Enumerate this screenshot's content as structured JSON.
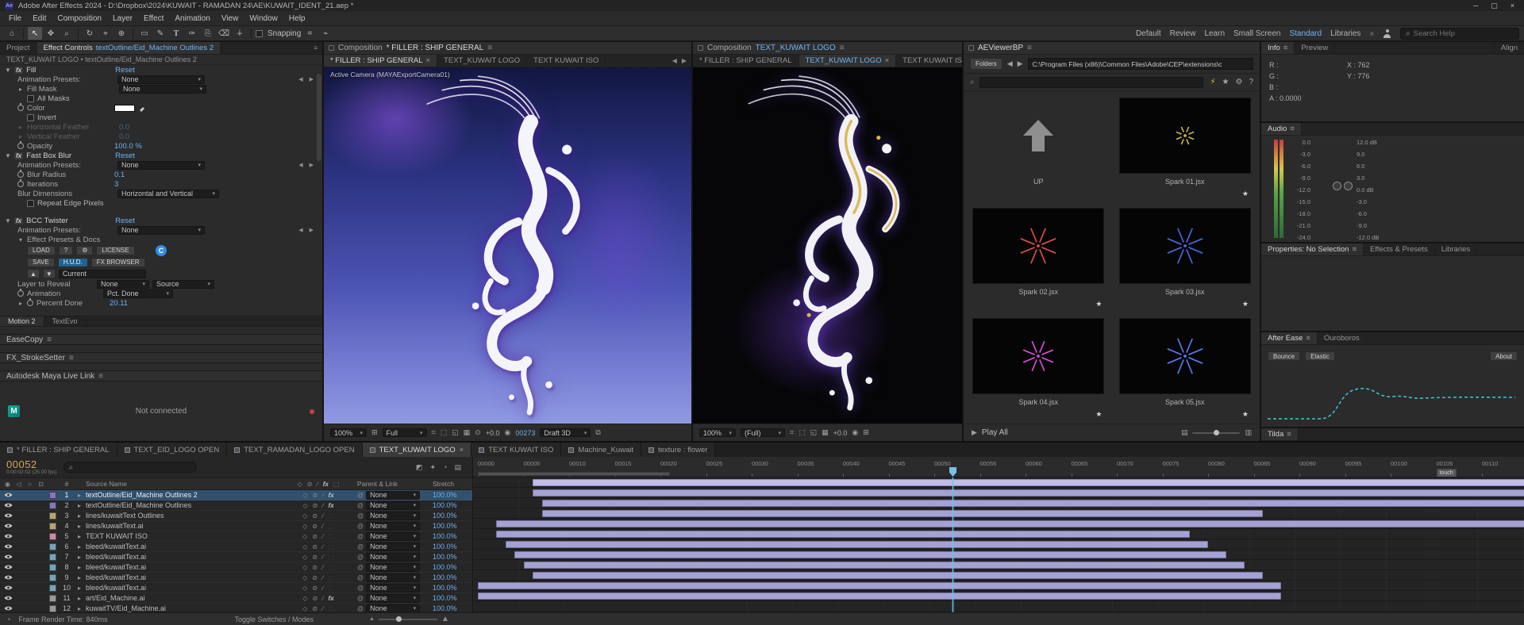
{
  "titlebar": {
    "title": "Adobe After Effects 2024 - D:\\Dropbox\\2024\\KUWAIT - RAMADAN 24\\AE\\KUWAIT_IDENT_21.aep *"
  },
  "menubar": [
    "File",
    "Edit",
    "Composition",
    "Layer",
    "Effect",
    "Animation",
    "View",
    "Window",
    "Help"
  ],
  "toolbar": {
    "snapping": "Snapping",
    "workspaces": [
      "Default",
      "Review",
      "Learn",
      "Small Screen",
      "Standard",
      "Libraries"
    ],
    "active_workspace": "Standard",
    "search_placeholder": "Search Help"
  },
  "effect_controls": {
    "project_tab": "Project",
    "panel_tab": "Effect Controls",
    "panel_target": "textOutline/Eid_Machine Outlines 2",
    "comp_crumb": "TEXT_KUWAIT LOGO • textOutline/Eid_Machine Outlines 2",
    "animation_presets_label": "Animation Presets:",
    "fill": {
      "name": "Fill",
      "reset": "Reset",
      "animation_presets": "None",
      "fill_mask_label": "Fill Mask",
      "fill_mask": "None",
      "all_masks": "All Masks",
      "color_label": "Color",
      "invert": "Invert",
      "h_feather_label": "Horizontal Feather",
      "h_feather": "0.0",
      "v_feather_label": "Vertical Feather",
      "v_feather": "0.0",
      "opacity_label": "Opacity",
      "opacity": "100.0 %"
    },
    "fast_box_blur": {
      "name": "Fast Box Blur",
      "reset": "Reset",
      "animation_presets": "None",
      "blur_radius_label": "Blur Radius",
      "blur_radius": "0.1",
      "iterations_label": "Iterations",
      "iterations": "3",
      "blur_dimensions_label": "Blur Dimensions",
      "blur_dimensions": "Horizontal and Vertical",
      "repeat_edge": "Repeat Edge Pixels"
    },
    "bcc_twister": {
      "name": "BCC Twister",
      "reset": "Reset",
      "animation_presets": "None",
      "presets_docs": "Effect Presets & Docs",
      "load": "LOAD",
      "help": "?",
      "license": "LICENSE",
      "save": "SAVE",
      "hud": "H.U.D.",
      "fx_browser": "FX BROWSER",
      "logo_letter": "C",
      "current": "Current",
      "layer_to_reveal_label": "Layer to Reveal",
      "layer_to_reveal": "None",
      "source": "Source",
      "animation_label": "Animation",
      "animation": "Pct. Done",
      "percent_done_label": "Percent Done",
      "percent_done": "20.11"
    },
    "bottom_tabs": [
      "Motion 2",
      "TextEvo"
    ],
    "easecopy": "EaseCopy",
    "fx_strokesetter": "FX_StrokeSetter",
    "maya_title": "Autodesk Maya Live Link",
    "maya_status": "Not connected"
  },
  "comp1": {
    "panel_title": "Composition",
    "panel_comp": "* FILLER : SHIP GENERAL",
    "tabs": [
      "* FILLER : SHIP GENERAL",
      "TEXT_KUWAIT LOGO",
      "TEXT KUWAIT ISO"
    ],
    "active_tab": 0,
    "camera_label": "Active Camera (MAYAExportCamera01)",
    "zoom": "100%",
    "resolution": "Full",
    "exposure": "+0.0",
    "frame": "00273",
    "renderer": "Draft 3D"
  },
  "comp2": {
    "panel_title": "Composition",
    "panel_comp": "TEXT_KUWAIT LOGO",
    "tabs": [
      "* FILLER : SHIP GENERAL",
      "TEXT_KUWAIT LOGO",
      "TEXT KUWAIT ISO"
    ],
    "active_tab": 1,
    "zoom": "100%",
    "resolution": "(Full)",
    "exposure": "+0.0"
  },
  "aeviewer": {
    "title": "AEViewerBP",
    "folders_button": "Folders",
    "path": "C:\\Program Files (x86)\\Common Files\\Adobe\\CEP\\extensions\\c",
    "items": [
      {
        "label": "UP",
        "type": "up"
      },
      {
        "label": "Spark 01.jsx",
        "type": "spark",
        "color": "#c7b24a",
        "size": 20
      },
      {
        "label": "Spark 02.jsx",
        "type": "spark",
        "color": "#e04a50",
        "size": 40
      },
      {
        "label": "Spark 03.jsx",
        "type": "spark",
        "color": "#4a66e0",
        "size": 40
      },
      {
        "label": "Spark 04.jsx",
        "type": "spark",
        "color": "#d84ad8",
        "size": 34
      },
      {
        "label": "Spark 05.jsx",
        "type": "spark",
        "color": "#5a7ae8",
        "size": 40
      }
    ],
    "play_all": "Play All"
  },
  "info_panel": {
    "tab_info": "Info",
    "tab_preview": "Preview",
    "tab_align": "Align",
    "r": "R :",
    "g": "G :",
    "b": "B :",
    "a": "A : 0.0000",
    "x": "X : 762",
    "y": "Y : 776"
  },
  "audio_panel": {
    "title": "Audio",
    "left_scale": [
      "0.0",
      "-3.0",
      "-6.0",
      "-9.0",
      "-12.0",
      "-15.0",
      "-18.0",
      "-21.0",
      "-24.0"
    ],
    "right_scale": [
      "12.0 dB",
      "9.0",
      "6.0",
      "3.0",
      "0.0 dB",
      "-3.0",
      "-6.0",
      "-9.0",
      "-12.0 dB"
    ]
  },
  "right_tabs": {
    "properties": "Properties: No Selection",
    "effects_presets": "Effects & Presets",
    "libraries": "Libraries"
  },
  "after_ease": {
    "tab1": "After Ease",
    "tab2": "Ouroboros",
    "bounce": "Bounce",
    "elastic": "Elastic",
    "about": "About"
  },
  "tilda": {
    "title": "Tilda"
  },
  "timeline": {
    "comp_tabs": [
      {
        "label": "* FILLER : SHIP GENERAL",
        "active": false
      },
      {
        "label": "TEXT_EID_LOGO OPEN",
        "active": false
      },
      {
        "label": "TEXT_RAMADAN_LOGO OPEN",
        "active": false
      },
      {
        "label": "TEXT_KUWAIT LOGO",
        "active": true
      },
      {
        "label": "TEXT KUWAIT ISO",
        "active": false
      },
      {
        "label": "Machine_Kuwait",
        "active": false
      },
      {
        "label": "texture : flower",
        "active": false
      }
    ],
    "timecode": "00052",
    "timecode_sub": "0:00:02:02 (25.00 fps)",
    "columns": {
      "source_name": "Source Name",
      "parent_link": "Parent & Link",
      "stretch": "Stretch",
      "number": "#"
    },
    "current_frame": 52,
    "work_area": {
      "start": 0,
      "end": 21
    },
    "marker_label": "touch",
    "marker_frame": 105,
    "ruler_ticks": [
      "00000",
      "00005",
      "00010",
      "00015",
      "00020",
      "00025",
      "00030",
      "00035",
      "00040",
      "00045",
      "00050",
      "00055",
      "00060",
      "00065",
      "00070",
      "00075",
      "00080",
      "00085",
      "00090",
      "00095",
      "00100",
      "00105",
      "00110"
    ],
    "layers": [
      {
        "num": "1",
        "name": "textOutline/Eid_Machine Outlines 2",
        "parent_link": "None",
        "stretch": "100.0%",
        "label_color": "#8577b5",
        "bar_start": 6,
        "bar_end": 116,
        "selected": true,
        "has_fx": true
      },
      {
        "num": "2",
        "name": "textOutline/Eid_Machine Outlines",
        "parent_link": "None",
        "stretch": "100.0%",
        "label_color": "#8577b5",
        "bar_start": 6,
        "bar_end": 116,
        "selected": false,
        "has_fx": true
      },
      {
        "num": "3",
        "name": "lines/kuwaitText Outlines",
        "parent_link": "None",
        "stretch": "100.0%",
        "label_color": "#b5a477",
        "bar_start": 7,
        "bar_end": 116,
        "selected": false,
        "has_fx": false
      },
      {
        "num": "4",
        "name": "lines/kuwaitText.ai",
        "parent_link": "None",
        "stretch": "100.0%",
        "label_color": "#b5a477",
        "bar_start": 7,
        "bar_end": 86,
        "selected": false,
        "has_fx": false
      },
      {
        "num": "5",
        "name": "TEXT KUWAIT ISO",
        "parent_link": "None",
        "stretch": "100.0%",
        "label_color": "#c98ba6",
        "bar_start": 2,
        "bar_end": 116,
        "selected": false,
        "has_fx": false
      },
      {
        "num": "6",
        "name": "bleed/kuwaitText.ai",
        "parent_link": "None",
        "stretch": "100.0%",
        "label_color": "#77a3b5",
        "bar_start": 2,
        "bar_end": 78,
        "selected": false,
        "has_fx": false
      },
      {
        "num": "7",
        "name": "bleed/kuwaitText.ai",
        "parent_link": "None",
        "stretch": "100.0%",
        "label_color": "#77a3b5",
        "bar_start": 3,
        "bar_end": 80,
        "selected": false,
        "has_fx": false
      },
      {
        "num": "8",
        "name": "bleed/kuwaitText.ai",
        "parent_link": "None",
        "stretch": "100.0%",
        "label_color": "#77a3b5",
        "bar_start": 4,
        "bar_end": 82,
        "selected": false,
        "has_fx": false
      },
      {
        "num": "9",
        "name": "bleed/kuwaitText.ai",
        "parent_link": "None",
        "stretch": "100.0%",
        "label_color": "#77a3b5",
        "bar_start": 5,
        "bar_end": 84,
        "selected": false,
        "has_fx": false
      },
      {
        "num": "10",
        "name": "bleed/kuwaitText.ai",
        "parent_link": "None",
        "stretch": "100.0%",
        "label_color": "#77a3b5",
        "bar_start": 6,
        "bar_end": 86,
        "selected": false,
        "has_fx": false
      },
      {
        "num": "11",
        "name": "art/Eid_Machine.ai",
        "parent_link": "None",
        "stretch": "100.0%",
        "label_color": "#9a9a9a",
        "bar_start": 0,
        "bar_end": 88,
        "selected": false,
        "has_fx": true
      },
      {
        "num": "12",
        "name": "kuwaitTV/Eid_Machine.ai",
        "parent_link": "None",
        "stretch": "100.0%",
        "label_color": "#9a9a9a",
        "bar_start": 0,
        "bar_end": 88,
        "selected": false,
        "has_fx": false
      }
    ],
    "frame_render": "Frame Render Time: 840ms",
    "toggle_label": "Toggle Switches / Modes"
  }
}
